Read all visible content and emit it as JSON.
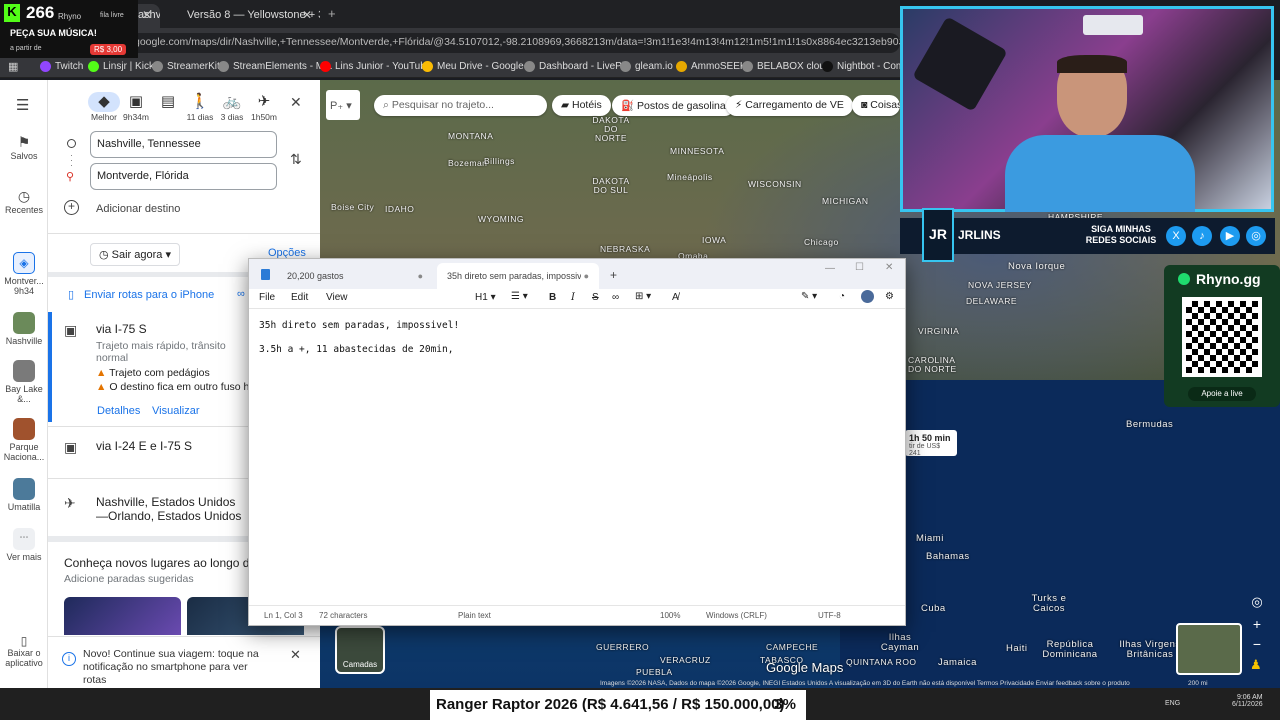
{
  "browser": {
    "tabs": [
      {
        "label": "Nashville, Tennessee, Montv"
      },
      {
        "label": "Versão 8 — Yellowstone + 3 dia"
      }
    ],
    "new_tab": "+",
    "url": "google.com/maps/dir/Nashville,+Tennessee/Montverde,+Flórida/@34.5107012,-98.2108969,3668213m/data=!3m1!1e3!4m13!4m12!1m5!1m1!1s0x8864ec3213eb903d:0x7d3fb9d0a1e9daa0!2m2",
    "bookmarks": [
      "Twitch",
      "Linsjr | Kick",
      "StreamerKit",
      "StreamElements - M...",
      "Lins Junior - YouTube",
      "Meu Drive - Google...",
      "Dashboard - LivePix",
      "gleam.io",
      "AmmoSEEK",
      "BELABOX cloud",
      "Nightbot - Comm"
    ]
  },
  "counter": {
    "value": "266",
    "label": "PEÇA SUA MÚSICA!",
    "price_prefix": "a partir de",
    "price": "R$ 3,00",
    "channel": "Rhyno",
    "queue": "fila livre"
  },
  "rail": {
    "saved": "Salvos",
    "recent": "Recentes",
    "current": "Montver...",
    "current_time": "9h34",
    "places": [
      "Nashville",
      "Bay Lake &...",
      "Parque Naciona...",
      "Umatilla"
    ],
    "more": "Ver mais",
    "download": "Baixar o aplicativo"
  },
  "directions": {
    "modes": [
      {
        "label": "Melhor",
        "icon": "◆"
      },
      {
        "label": "9h34m",
        "icon": "▣"
      },
      {
        "label": "",
        "icon": "▤"
      },
      {
        "label": "11 dias",
        "icon": "🚶"
      },
      {
        "label": "3 dias",
        "icon": "🚲"
      },
      {
        "label": "1h50m",
        "icon": "✈"
      }
    ],
    "origin": "Nashville, Tennessee",
    "destination": "Montverde, Flórida",
    "add_destination": "Adicionar destino",
    "depart": "Sair agora",
    "options": "Opções",
    "send": "Enviar rotas para o iPhone",
    "routes": [
      {
        "title": "via I-75 S",
        "desc": "Trajeto mais rápido, trânsito normal",
        "warn1": "Trajeto com pedágios",
        "warn2": "O destino fica em outro fuso ho",
        "details": "Detalhes",
        "view": "Visualizar"
      },
      {
        "title": "via I-24 E e I-75 S"
      },
      {
        "title": "Nashville, Estados Unidos—Orlando, Estados Unidos"
      }
    ],
    "discover_title": "Conheça novos lugares ao longo des",
    "discover_sub": "Adicione paradas sugeridas",
    "notice": "Novo! Continue sua viagem: toque na notificação no smartphone para ver rotas"
  },
  "map": {
    "search_placeholder": "Pesquisar no trajeto...",
    "chips": [
      "Hotéis",
      "Postos de gasolina",
      "Carregamento de VE",
      "Coisas"
    ],
    "labels": [
      "MONTANA",
      "DAKOTA DO NORTE",
      "MINNESOTA",
      "Bozeman",
      "Billings",
      "DAKOTA DO SUL",
      "Mineápolis",
      "WISCONSIN",
      "MICHIGAN",
      "Boise City",
      "IDAHO",
      "WYOMING",
      "IOWA",
      "Chicago",
      "NEBRASKA",
      "Omaha",
      "HAMPSHIRE",
      "Nova Iorque",
      "NOVA JERSEY",
      "DELAWARE",
      "VIRGINIA",
      "CAROLINA DO NORTE",
      "Bermudas",
      "Miami",
      "Bahamas",
      "Cuba",
      "Turks e Caicos",
      "Ilhas Cayman",
      "Jamaica",
      "Haiti",
      "República Dominicana",
      "Ilhas Virgens Britânicas",
      "GUERRERO",
      "VERACRUZ",
      "CAMPECHE",
      "PUEBLA",
      "TABASCO",
      "QUINTANA ROO"
    ],
    "duration": "1h 50 min",
    "duration_sub": "tir de US$ 241",
    "layers": "Camadas",
    "brand": "Google Maps",
    "attribution": "Imagens ©2026 NASA, Dados do mapa ©2026 Google, INEGI   Estados Unidos   A visualização em 3D do Earth não está disponível   Termos   Privacidade   Enviar feedback sobre o produto",
    "scale": "200 mi"
  },
  "notepad": {
    "tabs": [
      {
        "label": "20,200 gastos"
      },
      {
        "label": "35h direto sem paradas, impossivel"
      }
    ],
    "menu": [
      "File",
      "Edit",
      "View"
    ],
    "heading": "H1",
    "lines": [
      "35h direto sem paradas, impossivel!",
      "3.5h a +, 11 abastecidas de 20min,"
    ],
    "status": {
      "pos": "Ln 1, Col 3",
      "chars": "72 characters",
      "format": "Plain text",
      "zoom": "100%",
      "eol": "Windows (CRLF)",
      "enc": "UTF-8"
    }
  },
  "overlay": {
    "banner_text": "JRLINS",
    "follow": "SIGA MINHAS REDES SOCIAIS",
    "qr_brand": "Rhyno.gg",
    "qr_cta": "Apoie a live",
    "ticker": "Ranger Raptor 2026 (R$ 4.641,56 / R$ 150.000,00)",
    "ticker_pct": "3%",
    "clock": "9:06 AM",
    "date": "6/11/2026",
    "lang": "ENG"
  }
}
